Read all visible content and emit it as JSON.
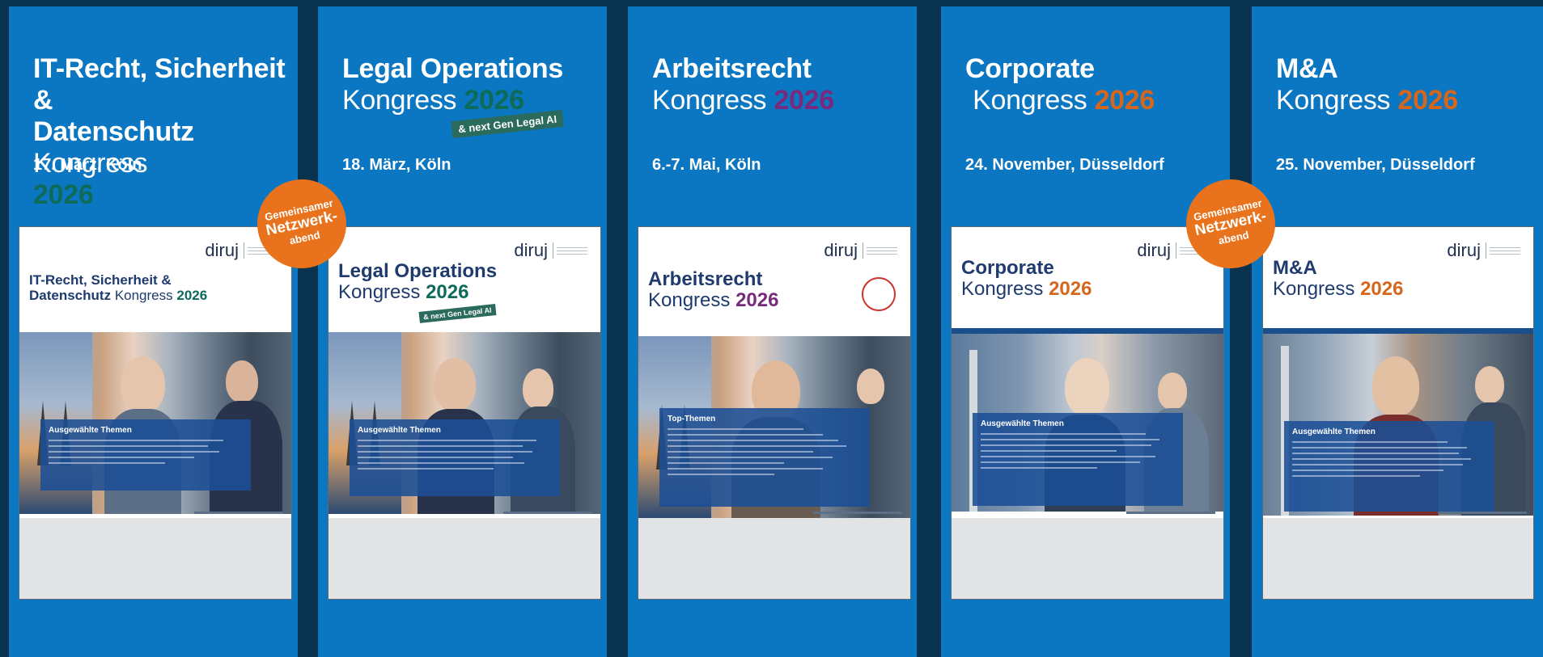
{
  "panels": [
    {
      "title_bold": "IT-Recht, Sicherheit &",
      "title_bold2": "Datenschutz",
      "title_reg": "Kongress",
      "year": "2026",
      "year_color": "#0e6b5a",
      "date": "17. März, Köln",
      "cover_title_bold": "IT-Recht, Sicherheit &",
      "cover_title_bold2": "Datenschutz",
      "cover_title_reg": "Kongress",
      "cover_year": "2026",
      "cover_topics": "Ausgewählte Themen",
      "logo": "diruj"
    },
    {
      "title_bold": "Legal Operations",
      "title_reg": "Kongress",
      "year": "2026",
      "year_color": "#0e6b5a",
      "badge": "& next Gen Legal AI",
      "date": "18. März, Köln",
      "cover_title_bold": "Legal Operations",
      "cover_title_reg": "Kongress",
      "cover_year": "2026",
      "cover_badge": "& next Gen Legal AI",
      "cover_topics": "Ausgewählte Themen",
      "logo": "diruj"
    },
    {
      "title_bold": "Arbeitsrecht",
      "title_reg": "Kongress",
      "year": "2026",
      "year_color": "#7a2a7d",
      "date": "6.-7. Mai, Köln",
      "cover_title_bold": "Arbeitsrecht",
      "cover_title_reg": "Kongress",
      "cover_year": "2026",
      "cover_topics": "Top-Themen",
      "logo": "diruj"
    },
    {
      "title_bold": "Corporate",
      "title_reg": "Kongress",
      "year": "2026",
      "year_color": "#d6661c",
      "date": "24. November, Düsseldorf",
      "cover_title_bold": "Corporate",
      "cover_title_reg": "Kongress",
      "cover_year": "2026",
      "cover_topics": "Ausgewählte Themen",
      "logo": "diruj"
    },
    {
      "title_bold": "M&A",
      "title_reg": "Kongress",
      "year": "2026",
      "year_color": "#d6661c",
      "date": "25. November, Düsseldorf",
      "cover_title_bold": "M&A",
      "cover_title_reg": "Kongress",
      "cover_year": "2026",
      "cover_topics": "Ausgewählte Themen",
      "logo": "diruj"
    }
  ],
  "seal": {
    "line1": "Gemeinsamer",
    "line2": "Netzwerk-",
    "line3": "abend",
    "color": "#e8731c"
  },
  "colors": {
    "background": "#08324d",
    "panel": "#0b76c1"
  }
}
